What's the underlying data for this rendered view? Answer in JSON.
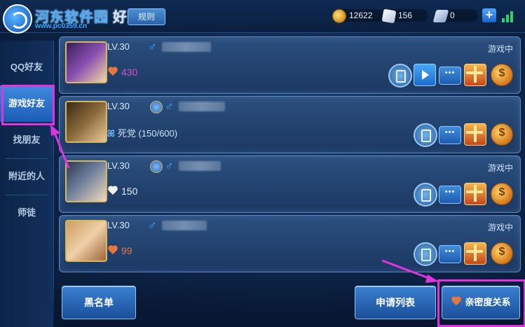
{
  "header": {
    "watermark_title": "河东软件园",
    "watermark_url": "www.pc0359.cn",
    "tab_title": "好友",
    "rule_button": "规则",
    "currencies": [
      {
        "icon": "gold-coin-icon",
        "value": "12622"
      },
      {
        "icon": "diamond-icon",
        "value": "156"
      },
      {
        "icon": "voucher-icon",
        "value": "0"
      }
    ]
  },
  "sidebar": {
    "items": [
      {
        "label": "QQ好友",
        "active": false
      },
      {
        "label": "游戏好友",
        "active": true
      },
      {
        "label": "找朋友",
        "active": false
      },
      {
        "label": "附近的人",
        "active": false
      },
      {
        "label": "师徒",
        "active": false
      }
    ]
  },
  "friends": [
    {
      "level": "LV.30",
      "gender": "♂",
      "status": "游戏中",
      "intimacy_value": "430",
      "intimacy_color": "#d94fc8",
      "relation": "",
      "actions": [
        "phone",
        "video",
        "chat",
        "gift",
        "coin"
      ]
    },
    {
      "level": "LV.30",
      "gender": "♂",
      "status": "",
      "intimacy_value": "",
      "intimacy_color": "#cfe0f5",
      "relation": "死党 (150/600)",
      "actions": [
        "phone",
        "chat",
        "gift",
        "coin"
      ]
    },
    {
      "level": "LV.30",
      "gender": "♂",
      "status": "游戏中",
      "intimacy_value": "150",
      "intimacy_color": "#e6eef9",
      "relation": "",
      "actions": [
        "phone",
        "chat",
        "gift",
        "coin"
      ]
    },
    {
      "level": "LV.30",
      "gender": "♂",
      "status": "游戏中",
      "intimacy_value": "99",
      "intimacy_color": "#e8783a",
      "relation": "",
      "actions": [
        "phone",
        "chat",
        "gift",
        "coin"
      ]
    }
  ],
  "footer": {
    "blacklist_button": "黑名单",
    "requests_button": "申请列表",
    "intimacy_button": "亲密度关系"
  },
  "colors": {
    "accent": "#2a6fc8",
    "highlight": "#e233e0",
    "gender_male": "#4aa3ff"
  }
}
